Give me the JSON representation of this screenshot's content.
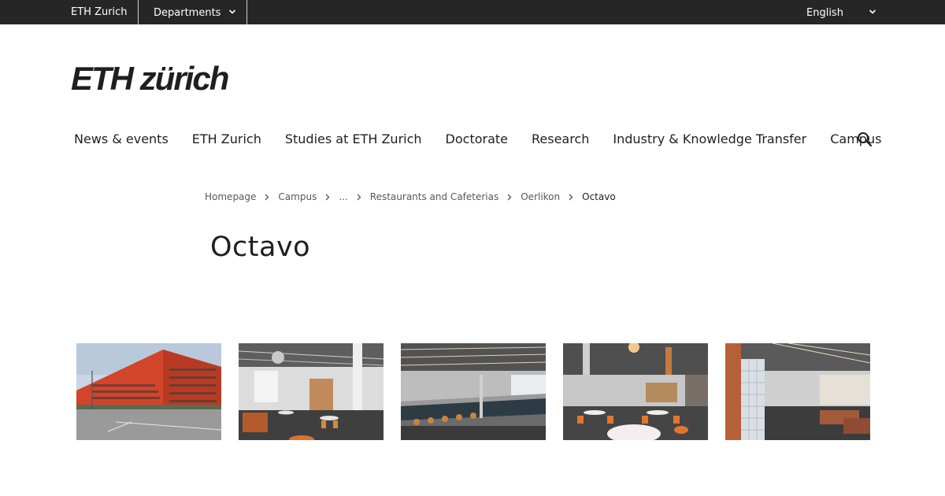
{
  "topbar": {
    "home_label": "ETH Zurich",
    "departments_label": "Departments",
    "language_label": "English"
  },
  "logo": {
    "text": "ETH zürich"
  },
  "nav": {
    "items": [
      "News & events",
      "ETH Zurich",
      "Studies at ETH Zurich",
      "Doctorate",
      "Research",
      "Industry & Knowledge Transfer",
      "Campus"
    ]
  },
  "icons": {
    "search": "search-icon",
    "chevron": "chevron-down-icon",
    "breadcrumb_separator": "chevron-right-icon"
  },
  "breadcrumb": {
    "items": [
      "Homepage",
      "Campus",
      "...",
      "Restaurants and Cafeterias",
      "Oerlikon",
      "Octavo"
    ]
  },
  "page": {
    "title": "Octavo"
  },
  "colors": {
    "topbar_bg": "#262626",
    "text": "#1f1f1f",
    "muted_text": "#575757"
  }
}
